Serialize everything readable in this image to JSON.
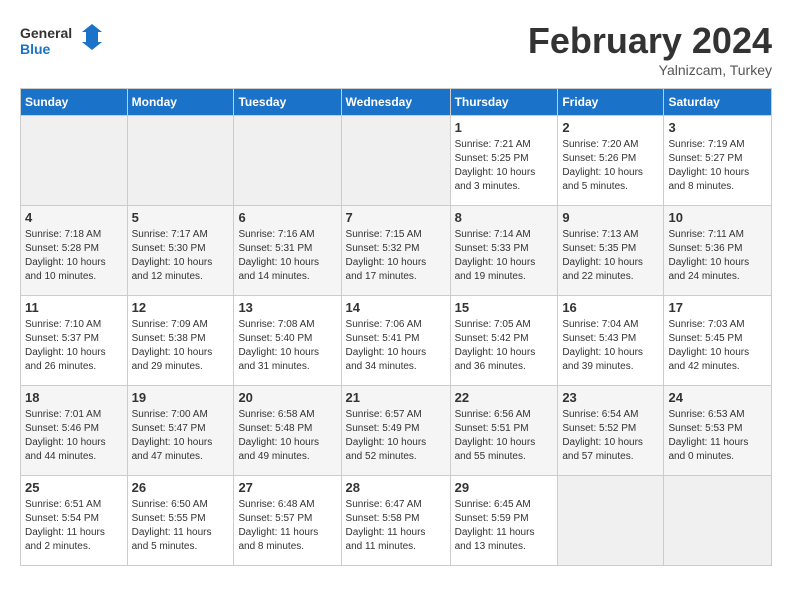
{
  "header": {
    "logo_general": "General",
    "logo_blue": "Blue",
    "month_title": "February 2024",
    "location": "Yalnizcam, Turkey"
  },
  "weekdays": [
    "Sunday",
    "Monday",
    "Tuesday",
    "Wednesday",
    "Thursday",
    "Friday",
    "Saturday"
  ],
  "weeks": [
    [
      {
        "day": "",
        "info": ""
      },
      {
        "day": "",
        "info": ""
      },
      {
        "day": "",
        "info": ""
      },
      {
        "day": "",
        "info": ""
      },
      {
        "day": "1",
        "info": "Sunrise: 7:21 AM\nSunset: 5:25 PM\nDaylight: 10 hours\nand 3 minutes."
      },
      {
        "day": "2",
        "info": "Sunrise: 7:20 AM\nSunset: 5:26 PM\nDaylight: 10 hours\nand 5 minutes."
      },
      {
        "day": "3",
        "info": "Sunrise: 7:19 AM\nSunset: 5:27 PM\nDaylight: 10 hours\nand 8 minutes."
      }
    ],
    [
      {
        "day": "4",
        "info": "Sunrise: 7:18 AM\nSunset: 5:28 PM\nDaylight: 10 hours\nand 10 minutes."
      },
      {
        "day": "5",
        "info": "Sunrise: 7:17 AM\nSunset: 5:30 PM\nDaylight: 10 hours\nand 12 minutes."
      },
      {
        "day": "6",
        "info": "Sunrise: 7:16 AM\nSunset: 5:31 PM\nDaylight: 10 hours\nand 14 minutes."
      },
      {
        "day": "7",
        "info": "Sunrise: 7:15 AM\nSunset: 5:32 PM\nDaylight: 10 hours\nand 17 minutes."
      },
      {
        "day": "8",
        "info": "Sunrise: 7:14 AM\nSunset: 5:33 PM\nDaylight: 10 hours\nand 19 minutes."
      },
      {
        "day": "9",
        "info": "Sunrise: 7:13 AM\nSunset: 5:35 PM\nDaylight: 10 hours\nand 22 minutes."
      },
      {
        "day": "10",
        "info": "Sunrise: 7:11 AM\nSunset: 5:36 PM\nDaylight: 10 hours\nand 24 minutes."
      }
    ],
    [
      {
        "day": "11",
        "info": "Sunrise: 7:10 AM\nSunset: 5:37 PM\nDaylight: 10 hours\nand 26 minutes."
      },
      {
        "day": "12",
        "info": "Sunrise: 7:09 AM\nSunset: 5:38 PM\nDaylight: 10 hours\nand 29 minutes."
      },
      {
        "day": "13",
        "info": "Sunrise: 7:08 AM\nSunset: 5:40 PM\nDaylight: 10 hours\nand 31 minutes."
      },
      {
        "day": "14",
        "info": "Sunrise: 7:06 AM\nSunset: 5:41 PM\nDaylight: 10 hours\nand 34 minutes."
      },
      {
        "day": "15",
        "info": "Sunrise: 7:05 AM\nSunset: 5:42 PM\nDaylight: 10 hours\nand 36 minutes."
      },
      {
        "day": "16",
        "info": "Sunrise: 7:04 AM\nSunset: 5:43 PM\nDaylight: 10 hours\nand 39 minutes."
      },
      {
        "day": "17",
        "info": "Sunrise: 7:03 AM\nSunset: 5:45 PM\nDaylight: 10 hours\nand 42 minutes."
      }
    ],
    [
      {
        "day": "18",
        "info": "Sunrise: 7:01 AM\nSunset: 5:46 PM\nDaylight: 10 hours\nand 44 minutes."
      },
      {
        "day": "19",
        "info": "Sunrise: 7:00 AM\nSunset: 5:47 PM\nDaylight: 10 hours\nand 47 minutes."
      },
      {
        "day": "20",
        "info": "Sunrise: 6:58 AM\nSunset: 5:48 PM\nDaylight: 10 hours\nand 49 minutes."
      },
      {
        "day": "21",
        "info": "Sunrise: 6:57 AM\nSunset: 5:49 PM\nDaylight: 10 hours\nand 52 minutes."
      },
      {
        "day": "22",
        "info": "Sunrise: 6:56 AM\nSunset: 5:51 PM\nDaylight: 10 hours\nand 55 minutes."
      },
      {
        "day": "23",
        "info": "Sunrise: 6:54 AM\nSunset: 5:52 PM\nDaylight: 10 hours\nand 57 minutes."
      },
      {
        "day": "24",
        "info": "Sunrise: 6:53 AM\nSunset: 5:53 PM\nDaylight: 11 hours\nand 0 minutes."
      }
    ],
    [
      {
        "day": "25",
        "info": "Sunrise: 6:51 AM\nSunset: 5:54 PM\nDaylight: 11 hours\nand 2 minutes."
      },
      {
        "day": "26",
        "info": "Sunrise: 6:50 AM\nSunset: 5:55 PM\nDaylight: 11 hours\nand 5 minutes."
      },
      {
        "day": "27",
        "info": "Sunrise: 6:48 AM\nSunset: 5:57 PM\nDaylight: 11 hours\nand 8 minutes."
      },
      {
        "day": "28",
        "info": "Sunrise: 6:47 AM\nSunset: 5:58 PM\nDaylight: 11 hours\nand 11 minutes."
      },
      {
        "day": "29",
        "info": "Sunrise: 6:45 AM\nSunset: 5:59 PM\nDaylight: 11 hours\nand 13 minutes."
      },
      {
        "day": "",
        "info": ""
      },
      {
        "day": "",
        "info": ""
      }
    ]
  ]
}
